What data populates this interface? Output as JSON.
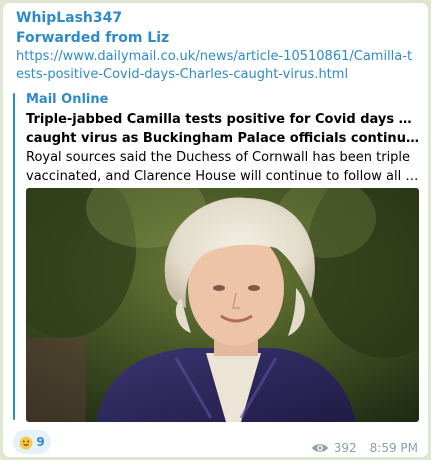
{
  "message": {
    "sender": "WhipLash347",
    "forwarded_from": "Forwarded from Liz",
    "link_url": "https://www.dailymail.co.uk/news/article-10510861/Camilla-tests-positive-Covid-days-Charles-caught-virus.html"
  },
  "preview": {
    "site_name": "Mail Online",
    "title_lines": [
      "Triple-jabbed Camilla tests positive for Covid days after Charles",
      "caught virus as Buckingham Palace officials continue to closel..."
    ],
    "description_lines": [
      "Royal sources said the Duchess of Cornwall has been triple",
      "vaccinated, and Clarence House will continue to follow all govern..."
    ]
  },
  "reaction": {
    "emoji_icon": "grinning-face-icon",
    "count": "9"
  },
  "footer": {
    "views_icon": "eye-icon",
    "views": "392",
    "time": "8:59 PM"
  },
  "colors": {
    "accent": "#2e8bc9",
    "background": "#dfe7d2",
    "bubble": "#ffffff",
    "meta": "#8aa0ab",
    "reaction_bg": "#e5f1fb"
  }
}
